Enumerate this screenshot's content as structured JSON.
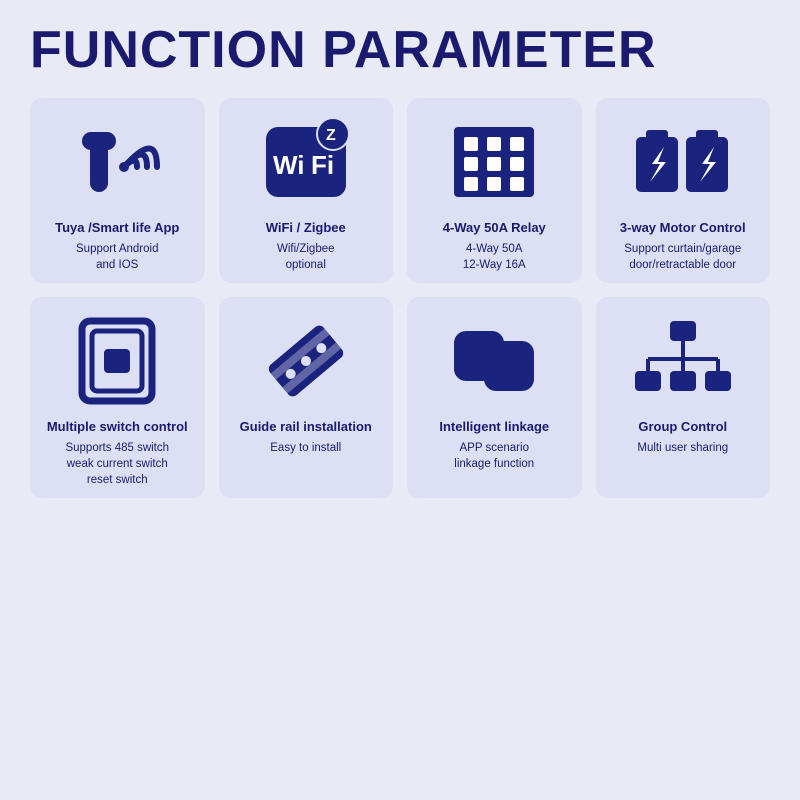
{
  "page": {
    "title": "FUNCTION PARAMETER",
    "bg_color": "#e8eaf6",
    "card_bg": "#dde0f5"
  },
  "cards": [
    {
      "id": "tuya",
      "icon": "tuya",
      "title": "Tuya /Smart life App",
      "sub": "Support Android\nand IOS"
    },
    {
      "id": "wifi",
      "icon": "wifi",
      "title": "WiFi / Zigbee",
      "sub": "Wifi/Zigbee\noptional"
    },
    {
      "id": "relay",
      "icon": "relay",
      "title": "4-Way 50A Relay",
      "sub": "4-Way 50A\n12-Way 16A"
    },
    {
      "id": "motor",
      "icon": "motor",
      "title": "3-way Motor Control",
      "sub": "Support curtain/garage\ndoor/retractable door"
    },
    {
      "id": "switch",
      "icon": "switch",
      "title": "Multiple switch control",
      "sub": "Supports 485 switch\nweak current switch\nreset switch"
    },
    {
      "id": "rail",
      "icon": "rail",
      "title": "Guide rail installation",
      "sub": "Easy to install"
    },
    {
      "id": "linkage",
      "icon": "linkage",
      "title": "Intelligent linkage",
      "sub": "APP scenario\nlinkage function"
    },
    {
      "id": "group",
      "icon": "group",
      "title": "Group Control",
      "sub": "Multi user sharing"
    }
  ]
}
